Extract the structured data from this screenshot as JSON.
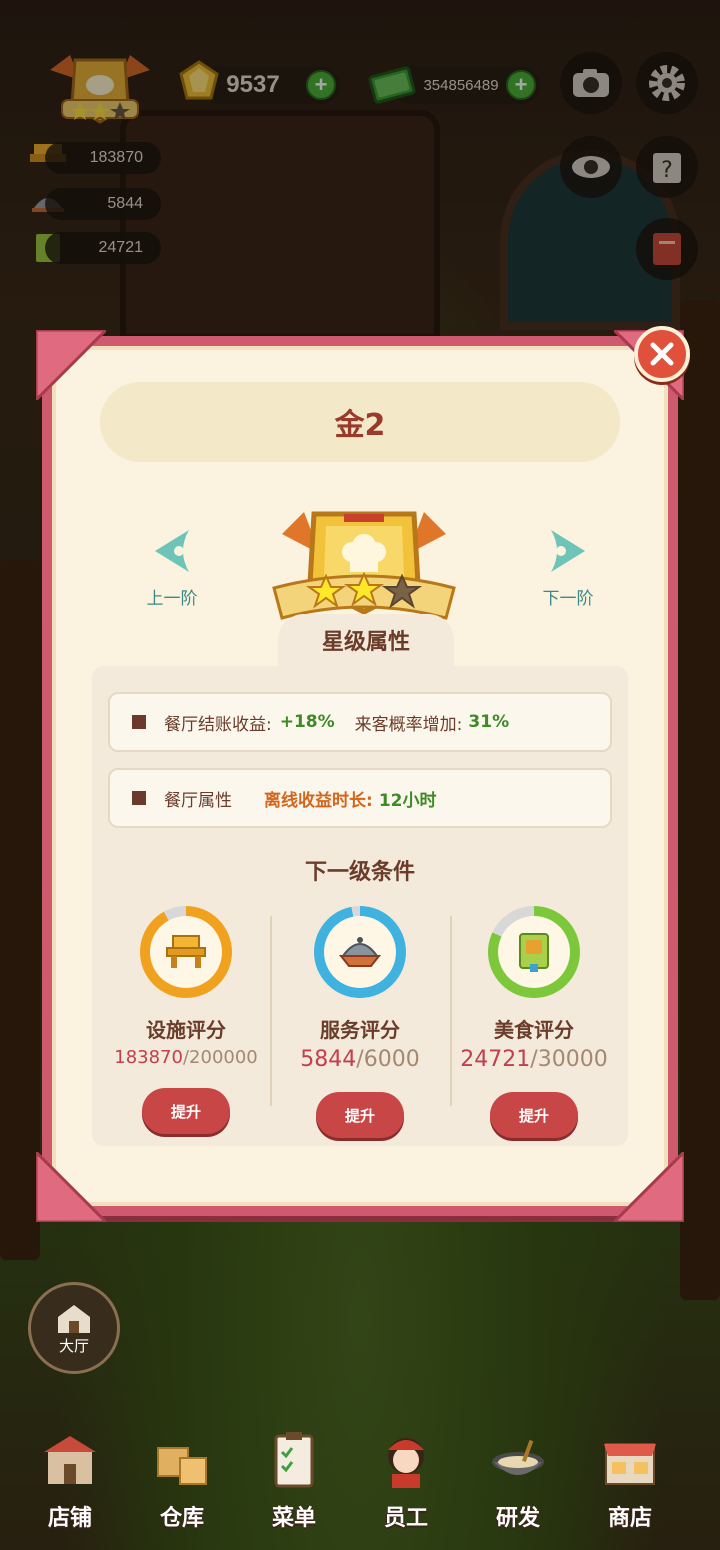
{
  "hud": {
    "gems": "9537",
    "cash": "354856489",
    "facility_score": "183870",
    "service_score": "5844",
    "food_score": "24721"
  },
  "modal": {
    "title": "金2",
    "prev_label": "上一阶",
    "next_label": "下一阶",
    "stars_filled": 2,
    "stars_total": 3,
    "section_title": "星级属性",
    "attr1": {
      "label": "餐厅结账收益:",
      "value1": "+18%",
      "label2": "来客概率增加:",
      "value2": "31%"
    },
    "attr2": {
      "label": "餐厅属性",
      "label2": "离线收益时长:",
      "value": "12小时"
    },
    "conditions_title": "下一级条件",
    "conditions": [
      {
        "name": "设施评分",
        "current": "183870",
        "target": "/200000",
        "button": "提升",
        "progress": 0.92,
        "color": "#f0a21e"
      },
      {
        "name": "服务评分",
        "current": "5844",
        "target": "/6000",
        "button": "提升",
        "progress": 0.97,
        "color": "#3fb2e0"
      },
      {
        "name": "美食评分",
        "current": "24721",
        "target": "/30000",
        "button": "提升",
        "progress": 0.82,
        "color": "#7cc83a"
      }
    ]
  },
  "hall_label": "大厅",
  "bottom_nav": [
    "店铺",
    "仓库",
    "菜单",
    "员工",
    "研发",
    "商店"
  ]
}
